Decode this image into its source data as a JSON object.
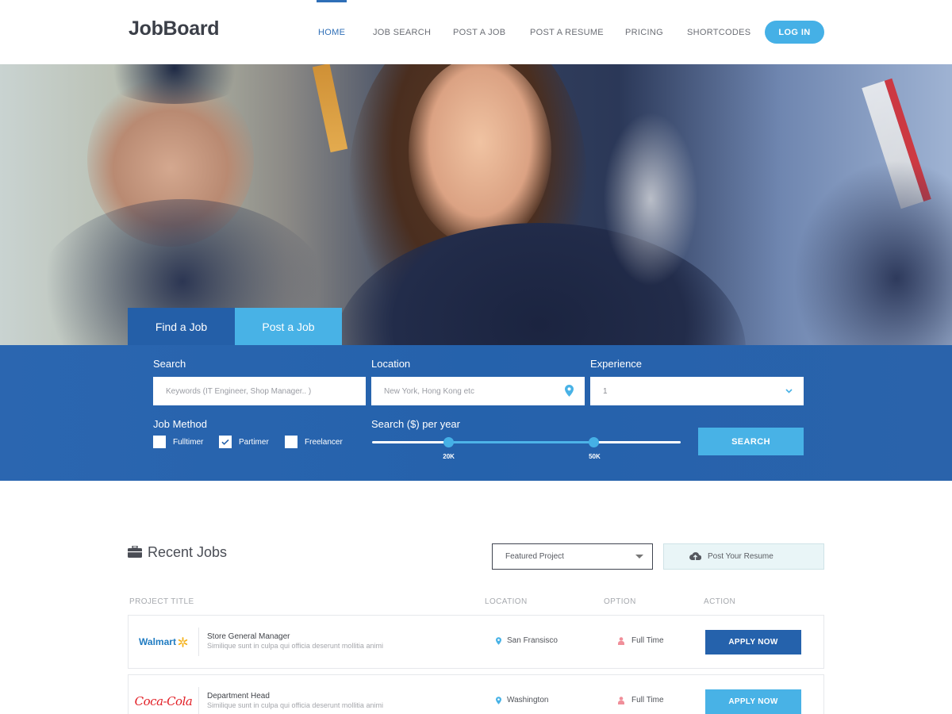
{
  "header": {
    "logo": "JobBoard",
    "nav": [
      {
        "label": "HOME",
        "active": true
      },
      {
        "label": "JOB SEARCH",
        "active": false
      },
      {
        "label": "POST A JOB",
        "active": false
      },
      {
        "label": "POST A RESUME",
        "active": false
      },
      {
        "label": "PRICING",
        "active": false
      },
      {
        "label": "SHORTCODES",
        "active": false
      }
    ],
    "login_label": "LOG IN"
  },
  "search_tabs": {
    "find": "Find a Job",
    "post": "Post a Job"
  },
  "search_form": {
    "search_label": "Search",
    "search_placeholder": "Keywords (IT Engineer, Shop Manager.. )",
    "location_label": "Location",
    "location_placeholder": "New York, Hong Kong etc",
    "experience_label": "Experience",
    "experience_value": "1",
    "job_method_label": "Job Method",
    "methods": [
      {
        "label": "Fulltimer",
        "checked": false
      },
      {
        "label": "Partimer",
        "checked": true
      },
      {
        "label": "Freelancer",
        "checked": false
      }
    ],
    "salary_label": "Search ($) per year",
    "salary_min_label": "20K",
    "salary_max_label": "50K",
    "salary_min_fraction": 0.25,
    "salary_max_fraction": 0.72,
    "search_button": "SEARCH"
  },
  "recent_jobs": {
    "title": "Recent Jobs",
    "filter_value": "Featured Project",
    "post_resume_label": "Post Your Resume",
    "columns": [
      "PROJECT TITLE",
      "LOCATION",
      "OPTION",
      "ACTION"
    ],
    "jobs": [
      {
        "company": "Walmart",
        "title": "Store General Manager",
        "description": "Similique sunt in culpa qui officia deserunt mollitia animi",
        "location": "San Fransisco",
        "option": "Full Time",
        "action": "APPLY NOW",
        "button_color": "#2562ac"
      },
      {
        "company": "Coca-Cola",
        "title": "Department Head",
        "description": "Similique sunt in culpa qui officia deserunt mollitia animi",
        "location": "Washington",
        "option": "Full Time",
        "action": "APPLY NOW",
        "button_color": "#48b2e6"
      }
    ]
  },
  "colors": {
    "primary": "#2562ac",
    "accent": "#48b2e6",
    "text_dark": "#3b3f48"
  }
}
